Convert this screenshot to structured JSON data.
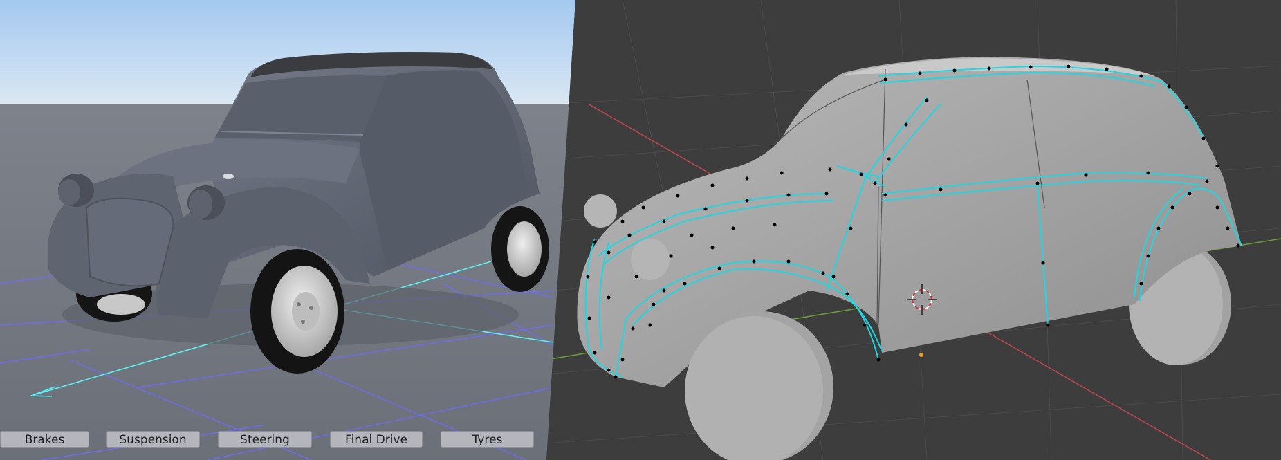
{
  "game_view": {
    "name": "car-preview-viewport",
    "tabs": [
      {
        "label": "Brakes"
      },
      {
        "label": "Suspension"
      },
      {
        "label": "Steering"
      },
      {
        "label": "Final Drive"
      },
      {
        "label": "Tyres"
      }
    ]
  },
  "editor_view": {
    "name": "3d-modeling-viewport",
    "mode": "edit-mode",
    "selection_color": "#21d6e0",
    "vertex_color": "#000000",
    "background": "#3d3d3d"
  },
  "colors": {
    "sky_top": "#a9cdf2",
    "sky_bottom": "#d8e7f4",
    "ground": "#737780",
    "car_body": "#5b616d",
    "grid_blue": "#6f6cf0",
    "grid_cyan": "#5ef0f2",
    "axis_red": "#b8464c",
    "axis_green": "#6a9a3c"
  }
}
